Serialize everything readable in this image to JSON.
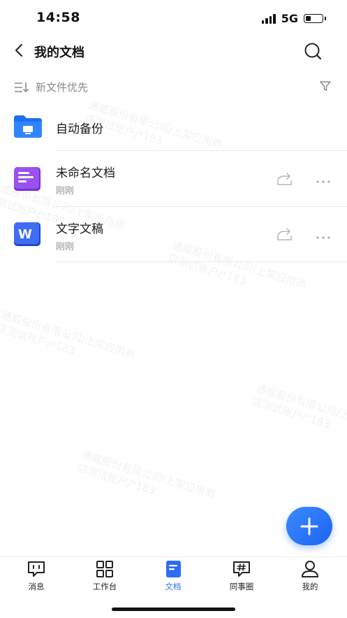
{
  "status_bar": {
    "time": "14:58",
    "network": "5G",
    "battery_level": 0.35
  },
  "nav": {
    "title": "我的文档"
  },
  "sort": {
    "label": "新文件优先"
  },
  "files": [
    {
      "title": "自动备份",
      "subtitle": "",
      "icon": "folder-icon",
      "color": "#1e6ff0"
    },
    {
      "title": "未命名文档",
      "subtitle": "刚刚",
      "icon": "doc-purple-icon",
      "color": "#8b3fe0"
    },
    {
      "title": "文字文稿",
      "subtitle": "刚刚",
      "icon": "word-icon",
      "color": "#2e5ee8",
      "icon_letter": "W"
    }
  ],
  "watermark": {
    "line1": "通威股份有限公司/上架应用商",
    "line2": "店测试账户/*183"
  },
  "tabs": [
    {
      "label": "消息",
      "icon": "message-icon"
    },
    {
      "label": "工作台",
      "icon": "grid-icon"
    },
    {
      "label": "文档",
      "icon": "document-icon",
      "active": true
    },
    {
      "label": "同事圈",
      "icon": "hashtag-chat-icon"
    },
    {
      "label": "我的",
      "icon": "person-icon"
    }
  ],
  "colors": {
    "accent": "#2d6cf6"
  }
}
